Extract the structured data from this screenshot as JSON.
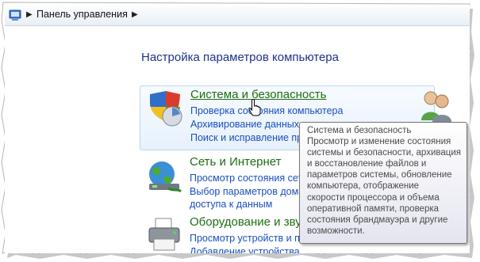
{
  "address_bar": {
    "breadcrumb": "Панель управления",
    "icon": "control-panel-icon",
    "separator_icon": "chevron-right-icon"
  },
  "heading": "Настройка параметров компьютера",
  "categories": [
    {
      "title": "Система и безопасность",
      "icon": "shield-icon",
      "links": [
        "Проверка состояния компьютера",
        "Архивирование данных компьютера",
        "Поиск и исправление проблем"
      ]
    },
    {
      "title": "Сеть и Интернет",
      "icon": "network-globe-icon",
      "links": [
        "Просмотр состояния сети и задач",
        "Выбор параметров домашней группы и",
        "доступа к данным"
      ]
    },
    {
      "title": "Оборудование и звук",
      "icon": "printer-icon",
      "links": [
        "Просмотр устройств и принтеров",
        "Добавление устройства"
      ]
    }
  ],
  "right_column_icon": "user-accounts-icon",
  "tooltip": {
    "lines": [
      "Система и безопасность",
      "Просмотр и изменение состояния",
      "системы и безопасности, архивация",
      "и восстановление файлов и",
      "параметров системы, обновление",
      "компьютера, отображение",
      "скорости процессора и объема",
      "оперативной памяти, проверка",
      "состояния брандмауэра и другие",
      "возможности."
    ]
  },
  "colors": {
    "heading": "#1e3287",
    "category_title": "#1e6e12",
    "link": "#1a4fbd",
    "hover_background": "#e7f1fc",
    "hover_border": "#b8d6f3"
  }
}
